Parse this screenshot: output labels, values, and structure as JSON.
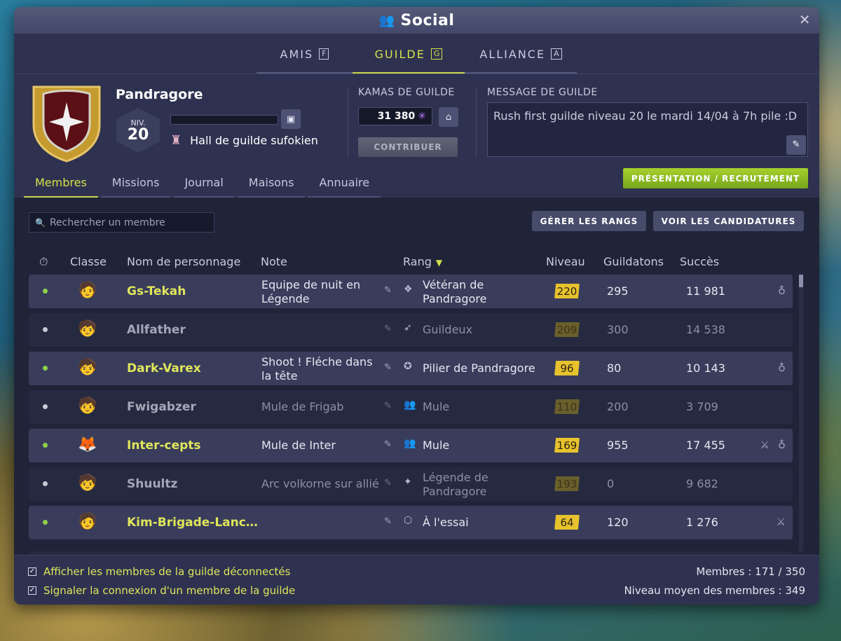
{
  "window": {
    "title": "Social",
    "close_icon": "close-icon"
  },
  "top_tabs": [
    {
      "label": "AMIS",
      "key": "F"
    },
    {
      "label": "GUILDE",
      "key": "G"
    },
    {
      "label": "ALLIANCE",
      "key": "A"
    }
  ],
  "guild": {
    "name": "Pandragore",
    "level_label": "NIV.",
    "level": "20",
    "hall": "Hall de guilde sufokien"
  },
  "kamas": {
    "label": "KAMAS DE GUILDE",
    "value": "31 380",
    "contribute": "CONTRIBUER"
  },
  "message": {
    "label": "MESSAGE DE GUILDE",
    "text": "Rush first guilde niveau 20 le mardi 14/04 à 7h pile :D"
  },
  "presentation_button": "PRÉSENTATION / RECRUTEMENT",
  "sub_tabs": [
    "Membres",
    "Missions",
    "Journal",
    "Maisons",
    "Annuaire"
  ],
  "search": {
    "placeholder": "Rechercher un membre"
  },
  "buttons": {
    "manage_ranks": "GÉRER LES RANGS",
    "see_applications": "VOIR LES CANDIDATURES"
  },
  "columns": {
    "class": "Classe",
    "name": "Nom de personnage",
    "note": "Note",
    "rank": "Rang",
    "level": "Niveau",
    "guildatons": "Guildatons",
    "success": "Succès"
  },
  "members": [
    {
      "online": true,
      "name": "Gs-Tekah",
      "note": "Equipe de nuit en Légende",
      "rank": "Vétéran de Pandragore",
      "level": "220",
      "guildatons": "295",
      "success": "11 981",
      "extras": [
        "pouch-icon"
      ]
    },
    {
      "online": false,
      "name": "Allfather",
      "note": "",
      "rank": "Guildeux",
      "level": "209",
      "guildatons": "300",
      "success": "14 538",
      "extras": []
    },
    {
      "online": true,
      "name": "Dark-Varex",
      "note": "Shoot ! Fléche dans la tête",
      "rank": "Pilier de Pandragore",
      "level": "96",
      "guildatons": "80",
      "success": "10 143",
      "extras": [
        "pouch-icon"
      ]
    },
    {
      "online": false,
      "name": "Fwigabzer",
      "note": "Mule de Frigab",
      "rank": "Mule",
      "level": "110",
      "guildatons": "200",
      "success": "3 709",
      "extras": []
    },
    {
      "online": true,
      "name": "Inter-cepts",
      "note": "Mule de Inter",
      "rank": "Mule",
      "level": "169",
      "guildatons": "955",
      "success": "17 455",
      "extras": [
        "crossed-swords-icon",
        "pouch-icon"
      ]
    },
    {
      "online": false,
      "name": "Shuultz",
      "note": "Arc volkorne sur allié",
      "rank": "Légende de Pandragore",
      "level": "193",
      "guildatons": "0",
      "success": "9 682",
      "extras": []
    },
    {
      "online": true,
      "name": "Kim-Brigade-Lanc…",
      "note": "",
      "rank": "À l'essai",
      "level": "64",
      "guildatons": "120",
      "success": "1 276",
      "extras": [
        "crossed-swords-icon"
      ]
    }
  ],
  "footer": {
    "show_offline": "Afficher les membres de la guilde déconnectés",
    "notify_connect": "Signaler la connexion d'un membre de la guilde",
    "members_count": "Membres : 171 / 350",
    "avg_level": "Niveau moyen des membres : 349"
  },
  "colors": {
    "accent": "#d7e14a",
    "online": "#8ed14b",
    "offline": "#c8cad8",
    "level_badge": "#e7c22d"
  }
}
